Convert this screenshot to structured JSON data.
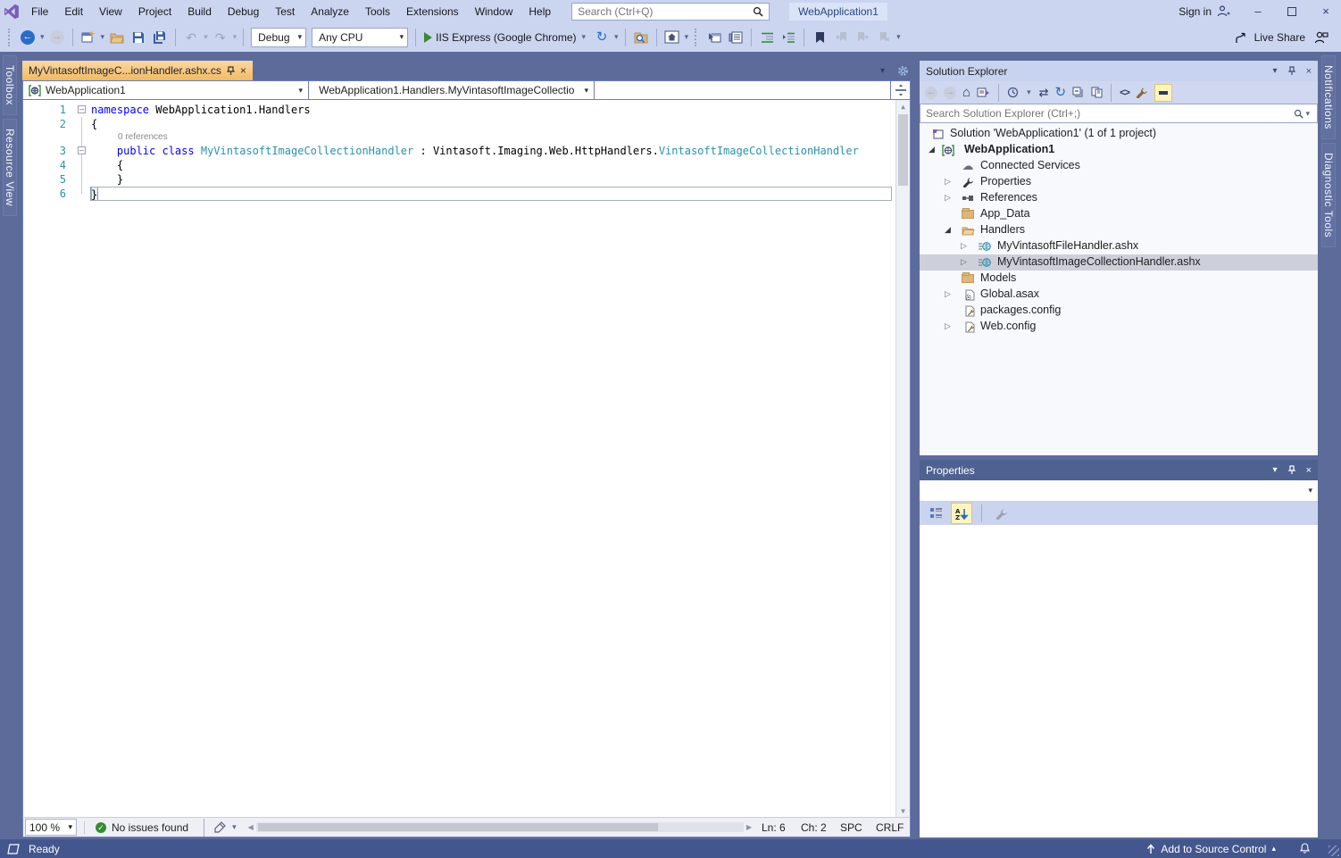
{
  "app": {
    "title_bar": {
      "menu_items": [
        "File",
        "Edit",
        "View",
        "Project",
        "Build",
        "Debug",
        "Test",
        "Analyze",
        "Tools",
        "Extensions",
        "Window",
        "Help"
      ],
      "search_placeholder": "Search (Ctrl+Q)",
      "window_button": "WebApplication1",
      "sign_in": "Sign in"
    },
    "toolbar": {
      "configuration": "Debug",
      "platform": "Any CPU",
      "run_target": "IIS Express (Google Chrome)",
      "live_share": "Live Share"
    },
    "left_tabs": [
      "Toolbox",
      "Resource View"
    ],
    "right_tabs": [
      "Notifications",
      "Diagnostic Tools"
    ]
  },
  "editor": {
    "tab_title": "MyVintasoftImageC...ionHandler.ashx.cs",
    "navbar": {
      "project": "WebApplication1",
      "member": "WebApplication1.Handlers.MyVintasoftImageCollectio"
    },
    "line_numbers": [
      "1",
      "2",
      "3",
      "4",
      "5",
      "6"
    ],
    "codelens": "0 references",
    "code": {
      "l1_kw": "namespace",
      "l1_rest": " WebApplication1.Handlers",
      "l2": "{",
      "l3_kw1": "    public ",
      "l3_kw2": "class ",
      "l3_type": "MyVintasoftImageCollectionHandler",
      "l3_colon": " : ",
      "l3_base_ns": "Vintasoft.Imaging.Web.HttpHandlers.",
      "l3_base_type": "VintasoftImageCollectionHandler",
      "l4": "    {",
      "l5": "    }",
      "l6": "}"
    },
    "status": {
      "zoom": "100 %",
      "health": "No issues found",
      "line": "Ln: 6",
      "column": "Ch: 2",
      "spaces": "SPC",
      "line_endings": "CRLF"
    }
  },
  "solution_explorer": {
    "title": "Solution Explorer",
    "search_placeholder": "Search Solution Explorer (Ctrl+;)",
    "tree": [
      {
        "label": "Solution 'WebApplication1' (1 of 1 project)"
      },
      {
        "label": "WebApplication1"
      },
      {
        "label": "Connected Services"
      },
      {
        "label": "Properties"
      },
      {
        "label": "References"
      },
      {
        "label": "App_Data"
      },
      {
        "label": "Handlers"
      },
      {
        "label": "MyVintasoftFileHandler.ashx"
      },
      {
        "label": "MyVintasoftImageCollectionHandler.ashx"
      },
      {
        "label": "Models"
      },
      {
        "label": "Global.asax"
      },
      {
        "label": "packages.config"
      },
      {
        "label": "Web.config"
      }
    ]
  },
  "properties_panel": {
    "title": "Properties"
  },
  "status_bar": {
    "ready": "Ready",
    "add_to_source_control": "Add to Source Control"
  },
  "glyphs": {
    "chevron_down": "▾",
    "chevron_up": "▴",
    "triangle_collapsed": "▷",
    "triangle_expanded": "◢",
    "undo": "↶",
    "redo": "↷",
    "refresh": "↻",
    "home": "⌂",
    "cloud": "☁",
    "back_arrow": "←",
    "forward_arrow": "→",
    "swap": "⇄",
    "minimize": "–",
    "close": "×",
    "pin": "⊤",
    "minus": "–",
    "scroll_up": "▲",
    "scroll_down": "▼",
    "scroll_left": "◀",
    "scroll_right": "▶",
    "check": "✓",
    "code_brackets": "<>",
    "bookmark_nav": [
      "⇤",
      "⇥",
      "⤬"
    ]
  },
  "colors": {
    "steel_background": "#5d6b9b",
    "titlebar": "#cbd5f0",
    "status_bar": "#43568d",
    "active_tab_top": "#fbd9a2",
    "active_tab_bottom": "#f2ba60",
    "keyword": "#0000ff",
    "type_name": "#2b91af",
    "line_number": "#2b91af",
    "inactive_selection": "#cdcfdb",
    "folder": "#dcb67a",
    "run_green": "#388a34",
    "properties_header": "#4e6190"
  }
}
